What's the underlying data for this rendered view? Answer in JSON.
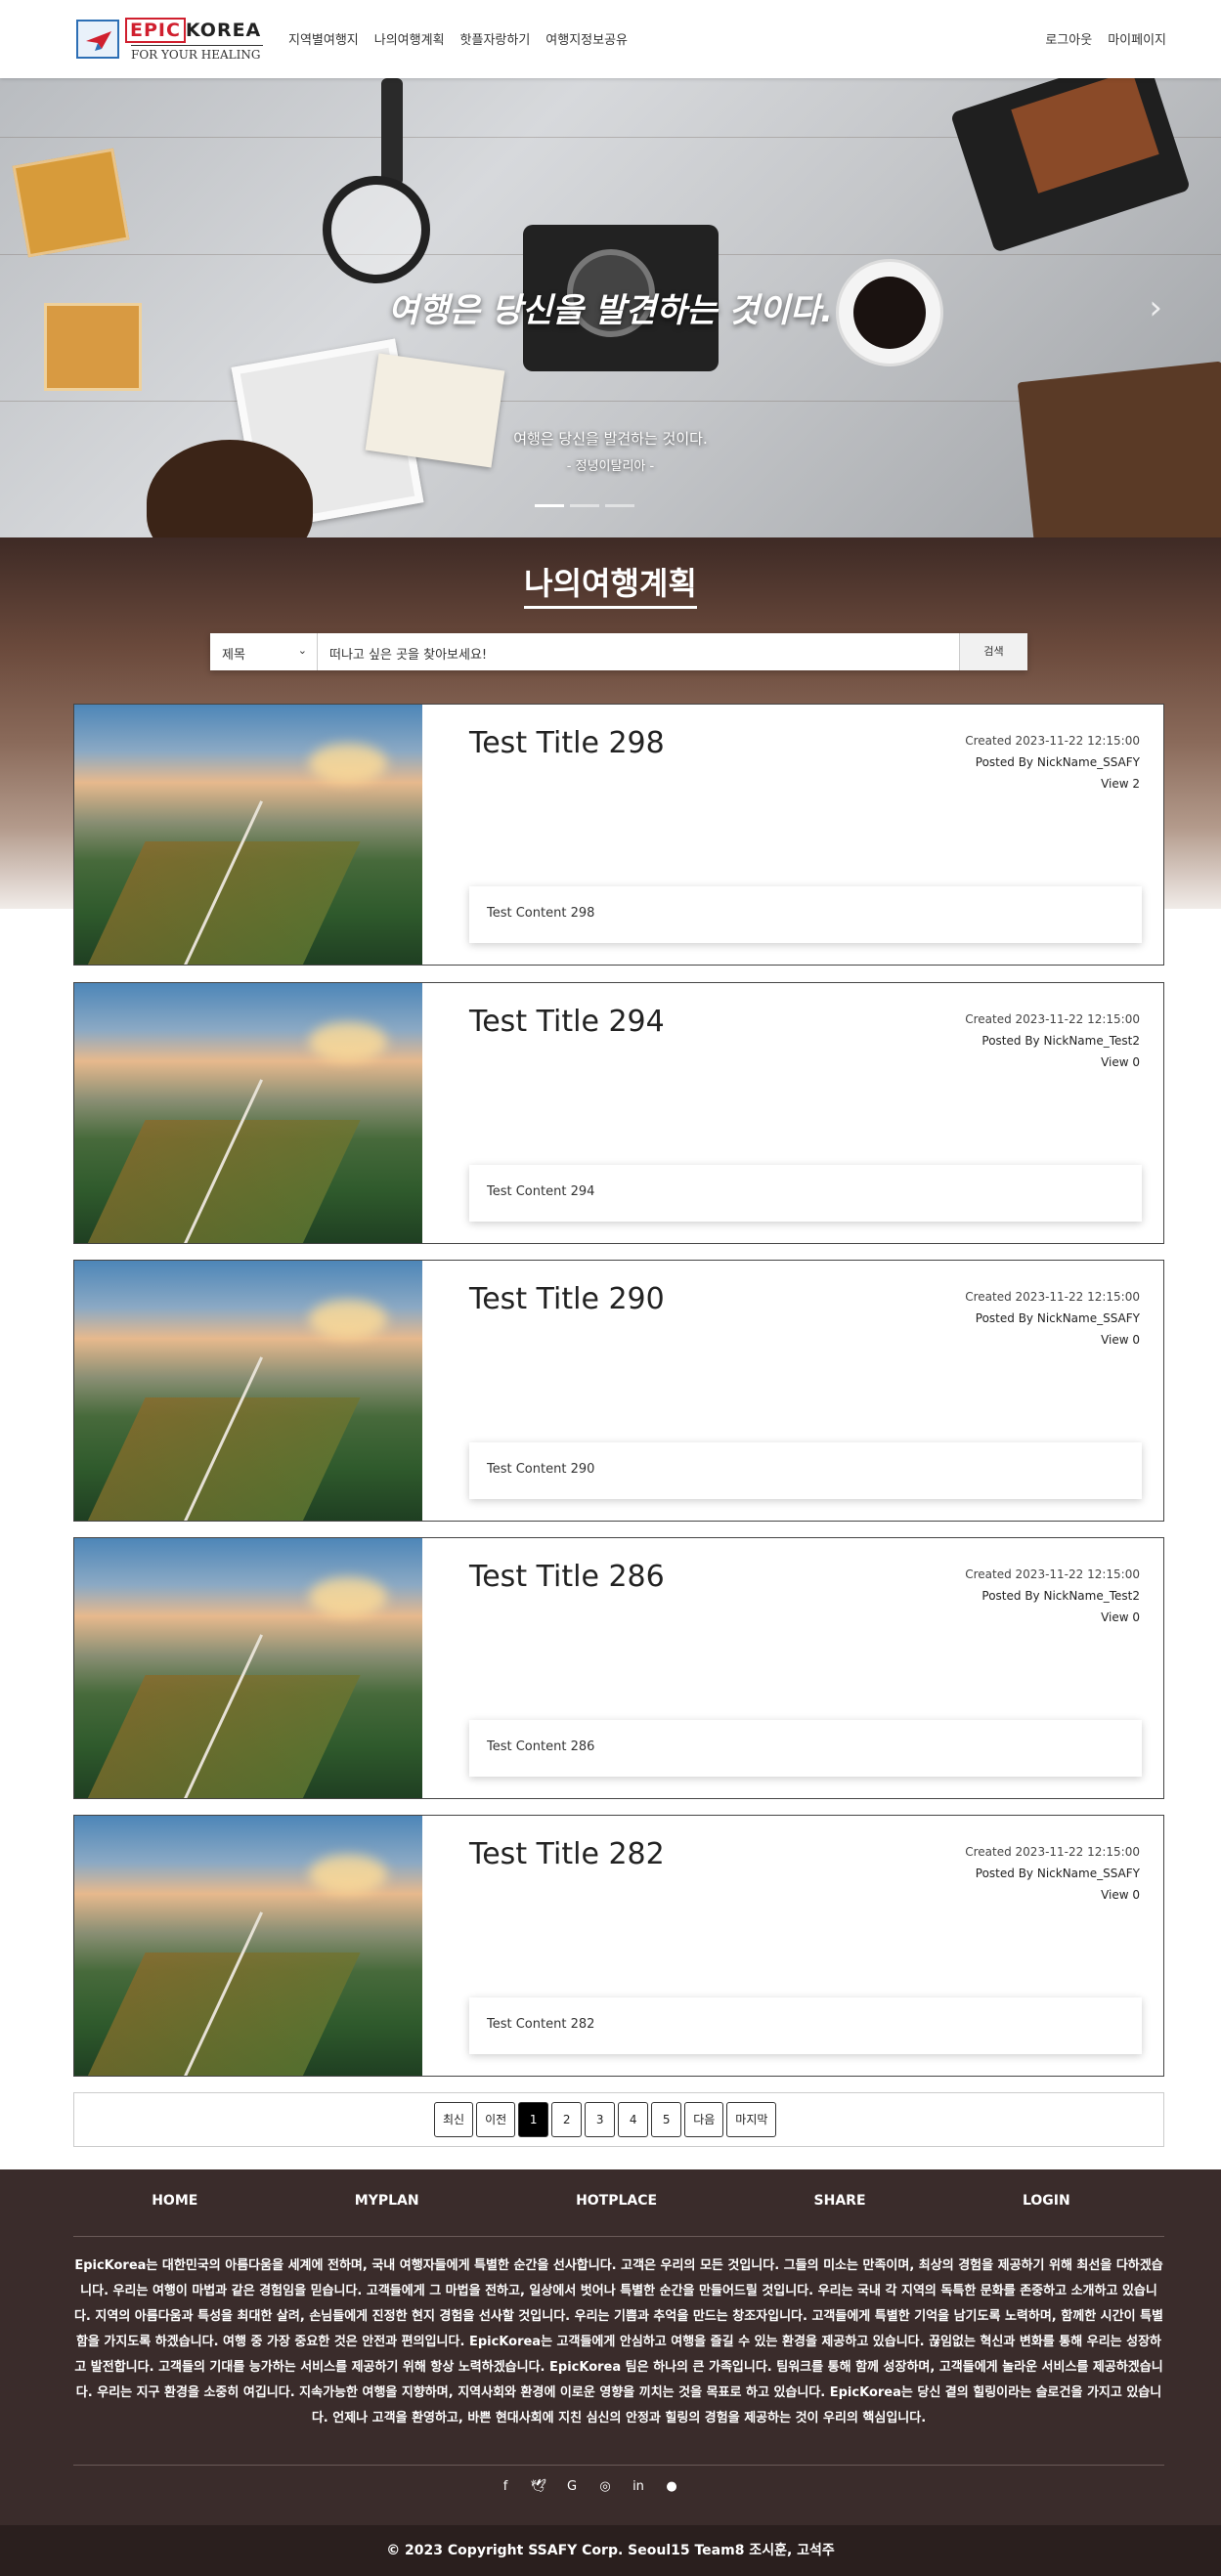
{
  "header": {
    "logo_brand_a": "EPIC",
    "logo_brand_b": "KOREA",
    "logo_sub": "FOR YOUR HEALING",
    "nav": [
      "지역별여행지",
      "나의여행계획",
      "핫플자랑하기",
      "여행지정보공유"
    ],
    "right": [
      "로그아웃",
      "마이페이지"
    ]
  },
  "hero": {
    "headline": "여행은 당신을 발견하는 것이다.",
    "caption": "여행은 당신을 발견하는 것이다.",
    "author": "- 정녕이탈리아 -",
    "next_icon": "chevron-right-icon"
  },
  "section": {
    "title": "나의여행계획"
  },
  "search": {
    "select_value": "제목",
    "placeholder": "떠나고 싶은 곳을 찾아보세요!",
    "button": "검색"
  },
  "posts": [
    {
      "title": "Test Title 298",
      "created": "Created 2023-11-22 12:15:00",
      "posted": "Posted By NickName_SSAFY",
      "views": "View 2",
      "content": "Test Content 298"
    },
    {
      "title": "Test Title 294",
      "created": "Created 2023-11-22 12:15:00",
      "posted": "Posted By NickName_Test2",
      "views": "View 0",
      "content": "Test Content 294"
    },
    {
      "title": "Test Title 290",
      "created": "Created 2023-11-22 12:15:00",
      "posted": "Posted By NickName_SSAFY",
      "views": "View 0",
      "content": "Test Content 290"
    },
    {
      "title": "Test Title 286",
      "created": "Created 2023-11-22 12:15:00",
      "posted": "Posted By NickName_Test2",
      "views": "View 0",
      "content": "Test Content 286"
    },
    {
      "title": "Test Title 282",
      "created": "Created 2023-11-22 12:15:00",
      "posted": "Posted By NickName_SSAFY",
      "views": "View 0",
      "content": "Test Content 282"
    }
  ],
  "pager": {
    "first": "최신",
    "prev": "이전",
    "pages": [
      "1",
      "2",
      "3",
      "4",
      "5"
    ],
    "current": "1",
    "next": "다음",
    "last": "마지막"
  },
  "footer": {
    "nav": [
      "HOME",
      "MYPLAN",
      "HOTPLACE",
      "SHARE",
      "LOGIN"
    ],
    "text": "EpicKorea는 대한민국의 아름다움을 세계에 전하며, 국내 여행자들에게 특별한 순간을 선사합니다. 고객은 우리의 모든 것입니다. 그들의 미소는 만족이며, 최상의 경험을 제공하기 위해 최선을 다하겠습니다. 우리는 여행이 마법과 같은 경험임을 믿습니다. 고객들에게 그 마법을 전하고, 일상에서 벗어나 특별한 순간을 만들어드릴 것입니다. 우리는 국내 각 지역의 독특한 문화를 존중하고 소개하고 있습니다. 지역의 아름다움과 특성을 최대한 살려, 손님들에게 진정한 현지 경험을 선사할 것입니다. 우리는 기쁨과 추억을 만드는 창조자입니다. 고객들에게 특별한 기억을 남기도록 노력하며, 함께한 시간이 특별함을 가지도록 하겠습니다. 여행 중 가장 중요한 것은 안전과 편의입니다. EpicKorea는 고객들에게 안심하고 여행을 즐길 수 있는 환경을 제공하고 있습니다. 끊임없는 혁신과 변화를 통해 우리는 성장하고 발전합니다. 고객들의 기대를 능가하는 서비스를 제공하기 위해 항상 노력하겠습니다. EpicKorea 팀은 하나의 큰 가족입니다. 팀워크를 통해 함께 성장하며, 고객들에게 놀라운 서비스를 제공하겠습니다. 우리는 지구 환경을 소중히 여깁니다. 지속가능한 여행을 지향하며, 지역사회와 환경에 이로운 영향을 끼치는 것을 목표로 하고 있습니다. EpicKorea는 당신 곁의 힐링이라는 슬로건을 가지고 있습니다. 언제나 고객을 환영하고, 바쁜 현대사회에 지친 심신의 안정과 힐링의 경험을 제공하는 것이 우리의 핵심입니다.",
    "social_icons": [
      "facebook-icon",
      "twitter-icon",
      "google-icon",
      "instagram-icon",
      "linkedin-icon",
      "github-icon"
    ],
    "copyright": "© 2023 Copyright SSAFY Corp. Seoul15 Team8 조시훈, 고석주"
  }
}
